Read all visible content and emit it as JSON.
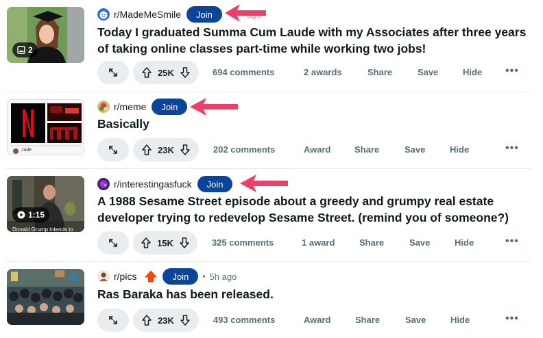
{
  "colors": {
    "join": "#0a449b",
    "arrow": "#ee3f6a",
    "pill": "#eaedef",
    "muted": "#576f76"
  },
  "posts": [
    {
      "subreddit": "r/MadeMeSmile",
      "join_label": "Join",
      "age": "ago",
      "title_line1": "Today I graduated Summa Cum Laude with my Associates after three years",
      "title_line2": "of taking online classes part-time while working two jobs!",
      "thumb_badge": "2",
      "thumb_badge_icon": "gallery-icon",
      "votes": "25K",
      "comments": "694 comments",
      "award": "2 awards",
      "share": "Share",
      "save": "Save",
      "hide": "Hide",
      "more": "•••"
    },
    {
      "subreddit": "r/meme",
      "join_label": "Join",
      "title_line1": "Basically",
      "thumb_caption": "Jade",
      "votes": "23K",
      "comments": "202 comments",
      "award": "Award",
      "share": "Share",
      "save": "Save",
      "hide": "Hide",
      "more": "•••"
    },
    {
      "subreddit": "r/interestingasfuck",
      "join_label": "Join",
      "title_line1": "A 1988 Sesame Street episode about a greedy and grumpy real estate",
      "title_line2": "developer trying to redevelop Sesame Street. (remind you of someone?)",
      "thumb_badge": "1:15",
      "thumb_badge_icon": "play-icon",
      "thumb_caption": "Donald Grump intends to",
      "votes": "15K",
      "comments": "325 comments",
      "award": "1 award",
      "share": "Share",
      "save": "Save",
      "hide": "Hide",
      "more": "•••"
    },
    {
      "subreddit": "r/pics",
      "join_label": "Join",
      "dot": "•",
      "age": "5h ago",
      "title_line1": "Ras Baraka has been released.",
      "votes": "23K",
      "comments": "493 comments",
      "award": "Award",
      "share": "Share",
      "save": "Save",
      "hide": "Hide",
      "more": "•••"
    }
  ]
}
